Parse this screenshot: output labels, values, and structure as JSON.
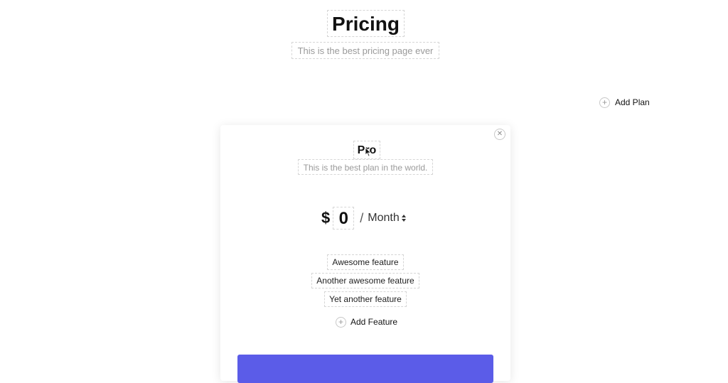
{
  "header": {
    "title": "Pricing",
    "subtitle": "This is the best pricing page ever"
  },
  "actions": {
    "add_plan_label": "Add Plan",
    "add_feature_label": "Add Feature"
  },
  "plan": {
    "name": "Pro",
    "description": "This is the best plan in the world.",
    "currency": "$",
    "price": "0",
    "price_separator": "/",
    "period": "Month",
    "features": [
      "Awesome feature",
      "Another awesome feature",
      "Yet another feature"
    ],
    "cta_label": ""
  },
  "icons": {
    "close": "close-icon",
    "add": "plus-circle-icon",
    "period_toggle": "up-down-arrows-icon",
    "cursor": "pointer-cursor-icon"
  },
  "colors": {
    "accent": "#5b5ce8",
    "muted_text": "#9a9a9a",
    "dashed_border": "#d6d6d6"
  }
}
